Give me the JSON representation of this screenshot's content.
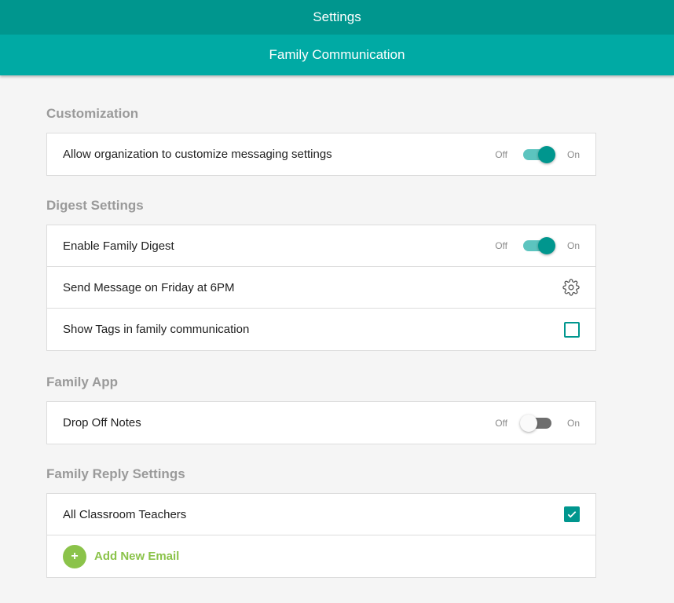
{
  "header": {
    "title": "Settings"
  },
  "subheader": {
    "title": "Family Communication"
  },
  "toggle_labels": {
    "off": "Off",
    "on": "On"
  },
  "sections": {
    "customization": {
      "title": "Customization",
      "rows": [
        {
          "label": "Allow organization to customize messaging settings",
          "toggle_on": true
        }
      ]
    },
    "digest": {
      "title": "Digest Settings",
      "rows": [
        {
          "label": "Enable Family Digest",
          "toggle_on": true
        },
        {
          "label": "Send Message on Friday at 6PM",
          "icon": "gear-icon"
        },
        {
          "label": "Show Tags in family communication",
          "checked": false
        }
      ]
    },
    "family_app": {
      "title": "Family App",
      "rows": [
        {
          "label": "Drop Off Notes",
          "toggle_on": false
        }
      ]
    },
    "reply": {
      "title": "Family Reply Settings",
      "rows": [
        {
          "label": "All Classroom Teachers",
          "checked": true
        }
      ],
      "add_label": "Add New Email",
      "add_icon": "plus-icon"
    }
  },
  "colors": {
    "header": "#00968e",
    "subheader": "#00aaa4",
    "accent": "#00968e",
    "add_green": "#8bc34a"
  }
}
